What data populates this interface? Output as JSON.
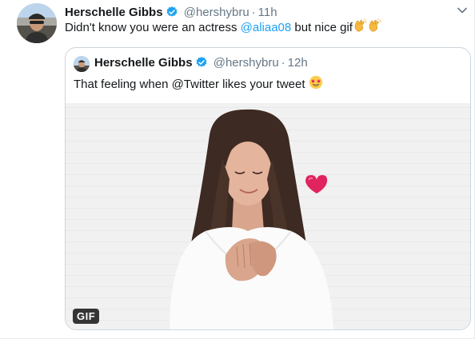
{
  "tweet": {
    "author_name": "Herschelle Gibbs",
    "handle": "@hershybru",
    "separator": "·",
    "time": "11h",
    "text_before": "Didn't know you were an actress ",
    "mention": "@aliaa08",
    "text_after": " but nice gif",
    "emojis": [
      "clapping-hands",
      "clapping-hands"
    ]
  },
  "quoted_tweet": {
    "author_name": "Herschelle Gibbs",
    "handle": "@hershybru",
    "separator": "·",
    "time": "12h",
    "text": "That feeling when @Twitter likes your tweet ",
    "emoji": "star-struck",
    "media_badge": "GIF"
  },
  "colors": {
    "verified": "#1da1f2",
    "mention": "#1da1f2",
    "secondary_text": "#657786",
    "border": "#ccd6dd",
    "heart": "#e0245e"
  }
}
